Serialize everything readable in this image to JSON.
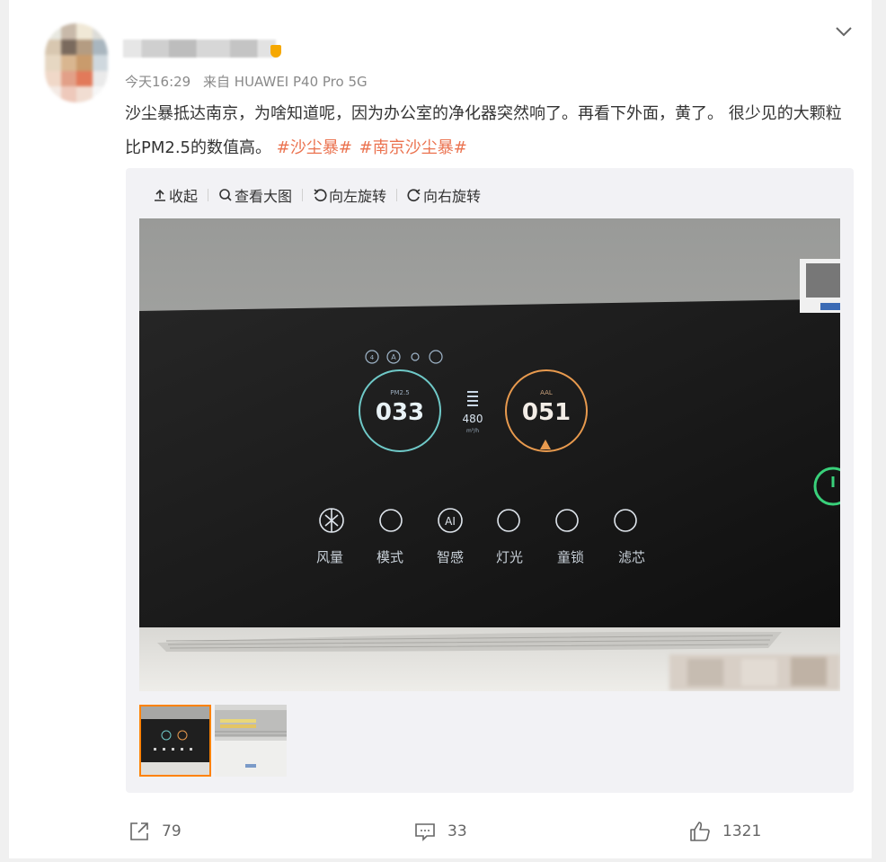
{
  "post": {
    "time": "今天16:29",
    "source": "来自 HUAWEI P40 Pro 5G",
    "text": "沙尘暴抵达南京，为啥知道呢，因为办公室的净化器突然响了。再看下外面，黄了。 很少见的大颗粒比PM2.5的数值高。 ",
    "tags": [
      "#沙尘暴#",
      "#南京沙尘暴#"
    ]
  },
  "toolbar": {
    "collapse": "收起",
    "view_large": "查看大图",
    "rotate_left": "向左旋转",
    "rotate_right": "向右旋转"
  },
  "photo": {
    "pm25_label": "PM2.5",
    "pm25_value": "033",
    "airflow_value": "480",
    "airflow_unit": "m³/h",
    "aal_label": "AAL",
    "aal_value": "051",
    "buttons": [
      "风量",
      "模式",
      "智感",
      "灯光",
      "童锁",
      "滤芯"
    ]
  },
  "actions": {
    "forward": "79",
    "comment": "33",
    "like": "1321"
  },
  "icons": [
    "chevron-down-icon",
    "upload-arrow-icon",
    "magnifier-icon",
    "rotate-left-icon",
    "rotate-right-icon",
    "share-icon",
    "comment-icon",
    "like-icon"
  ]
}
